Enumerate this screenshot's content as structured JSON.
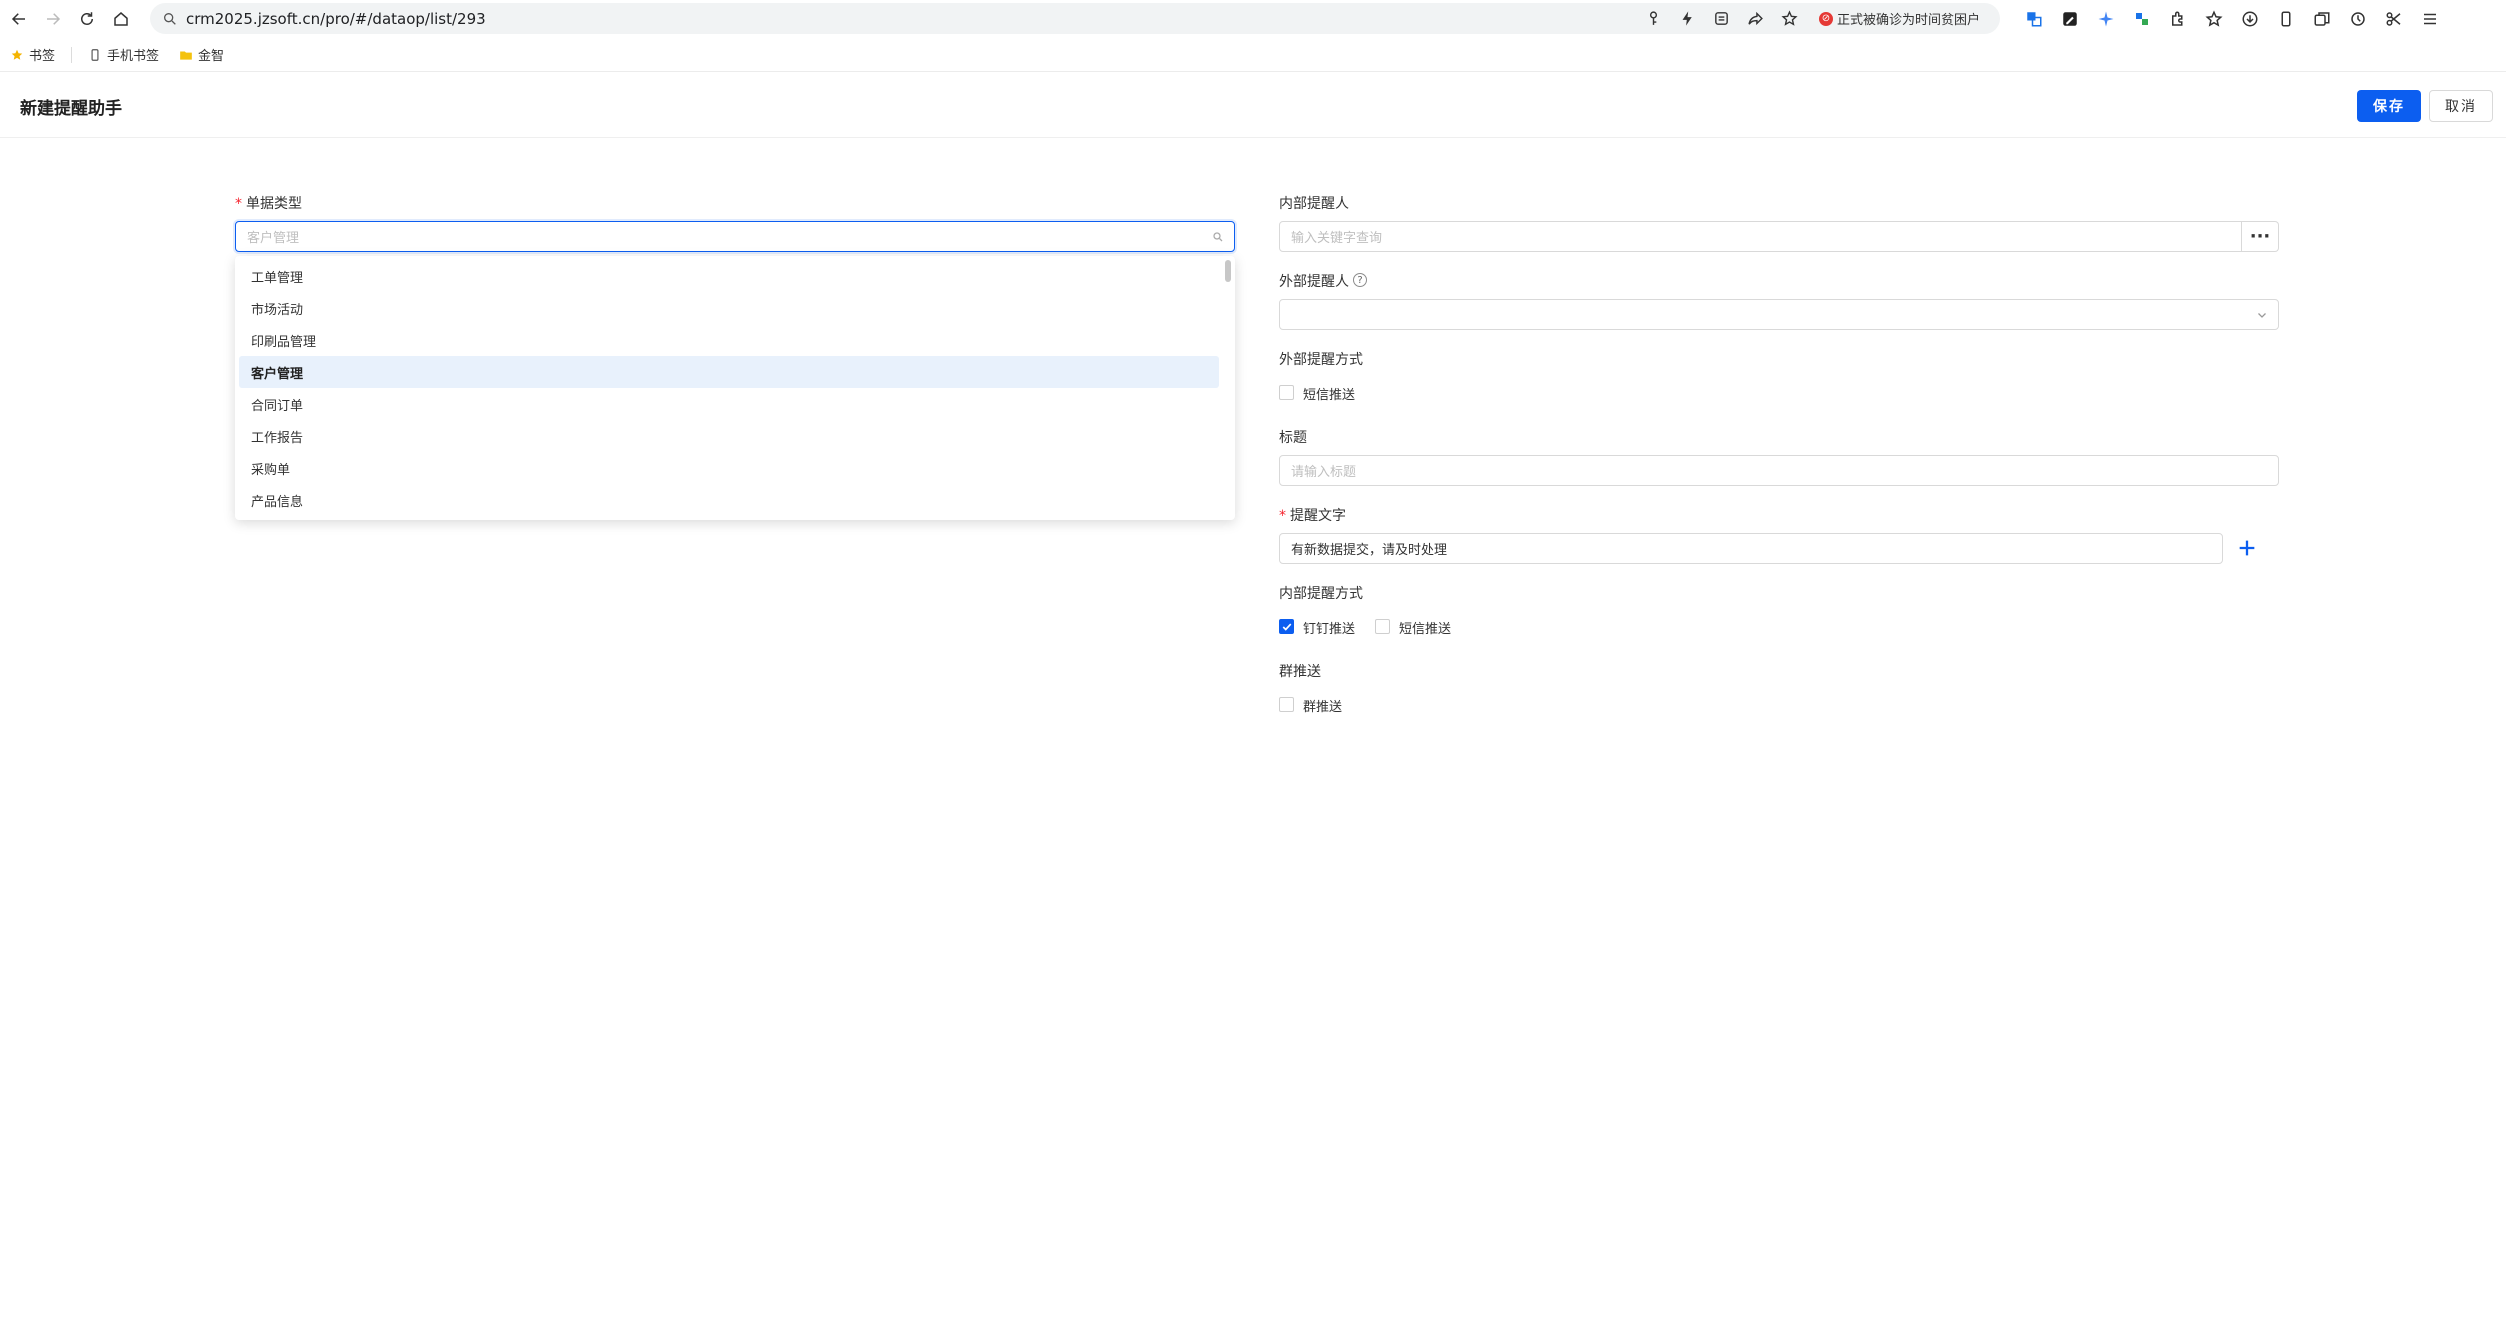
{
  "browser": {
    "url": "crm2025.jzsoft.cn/pro/#/dataop/list/293",
    "warning": "正式被确诊为时间贫困户",
    "bookmarks": [
      "书签",
      "手机书签",
      "金智"
    ]
  },
  "header": {
    "title": "新建提醒助手",
    "save_label": "保存",
    "cancel_label": "取消"
  },
  "form": {
    "doc_type": {
      "label": "单据类型",
      "placeholder": "客户管理",
      "options": [
        "工单管理",
        "市场活动",
        "印刷品管理",
        "客户管理",
        "合同订单",
        "工作报告",
        "采购单",
        "产品信息"
      ],
      "selected": "客户管理"
    },
    "internal_reminder": {
      "label": "内部提醒人",
      "placeholder": "输入关键字查询",
      "more": "···"
    },
    "external_reminder": {
      "label": "外部提醒人",
      "help": "?"
    },
    "external_method": {
      "label": "外部提醒方式",
      "options": [
        {
          "label": "短信推送",
          "checked": false
        }
      ]
    },
    "title": {
      "label": "标题",
      "placeholder": "请输入标题"
    },
    "reminder_text": {
      "label": "提醒文字",
      "value": "有新数据提交，请及时处理"
    },
    "internal_method": {
      "label": "内部提醒方式",
      "options": [
        {
          "label": "钉钉推送",
          "checked": true
        },
        {
          "label": "短信推送",
          "checked": false
        }
      ]
    },
    "group_push": {
      "label": "群推送",
      "options": [
        {
          "label": "群推送",
          "checked": false
        }
      ]
    }
  },
  "colors": {
    "primary": "#0c5ef0",
    "required": "#f5222d",
    "selected_bg": "#e8f1fc"
  }
}
